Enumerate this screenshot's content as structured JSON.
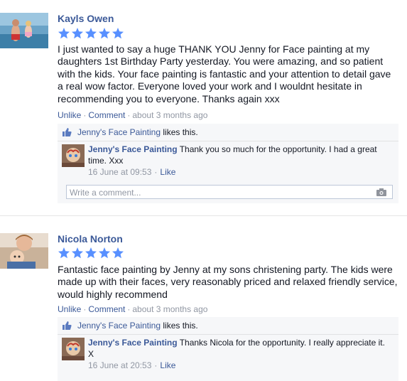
{
  "reviews": [
    {
      "author": "Kayls Owen",
      "rating": 5,
      "text": "I just wanted to say a huge THANK YOU Jenny for Face painting at my daughters 1st Birthday Party yesterday. You were amazing, and so patient with the kids. Your face painting is fantastic and your attention to detail gave a real wow factor. Everyone loved your work and I wouldnt hesitate in recommending you to everyone. Thanks again xxx",
      "unlike": "Unlike",
      "comment": "Comment",
      "time": "about 3 months ago",
      "likes_page": "Jenny's Face Painting",
      "likes_suffix": "likes this.",
      "reply_author": "Jenny's Face Painting",
      "reply_text": "Thank you so much for the opportunity. I had a great time. Xxx",
      "reply_date": "16 June at 09:53",
      "reply_like": "Like",
      "write_placeholder": "Write a comment..."
    },
    {
      "author": "Nicola Norton",
      "rating": 5,
      "text": "Fantastic face painting by Jenny at my sons christening party. The kids were made up with their faces, very reasonably priced and relaxed friendly service, would highly recommend",
      "unlike": "Unlike",
      "comment": "Comment",
      "time": "about 3 months ago",
      "likes_page": "Jenny's Face Painting",
      "likes_suffix": "likes this.",
      "reply_author": "Jenny's Face Painting",
      "reply_text": "Thanks Nicola for the opportunity. I really appreciate it. X",
      "reply_date": "16 June at 20:53",
      "reply_like": "Like"
    }
  ],
  "colors": {
    "link": "#3b5998",
    "star": "#5890ff",
    "muted": "#9197a3",
    "comment_bg": "#f6f7f9"
  },
  "icons": {
    "star": "star-icon",
    "thumb": "thumbs-up-icon",
    "camera": "camera-icon"
  }
}
